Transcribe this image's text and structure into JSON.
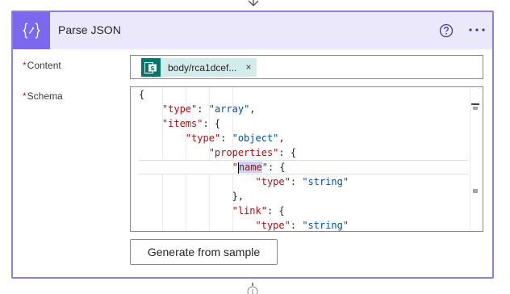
{
  "action": {
    "title": "Parse JSON",
    "icon": "curly-braces-icon",
    "accent_color": "#7b68ee",
    "header_bg": "#ece8fb",
    "border_color": "#8f7fe0"
  },
  "header_actions": {
    "help_icon": "question-circle-icon",
    "more_icon": "ellipsis-icon"
  },
  "fields": {
    "content": {
      "required_marker": "*",
      "label": "Content",
      "token": {
        "label": "body/rca1dcef...",
        "close": "×",
        "icon": "sharepoint-icon",
        "color": "#077568"
      }
    },
    "schema": {
      "required_marker": "*",
      "label": "Schema",
      "lines": [
        "{",
        "    \"type\": \"array\",",
        "    \"items\": {",
        "        \"type\": \"object\",",
        "        \"properties\": {",
        "            \"name\": {",
        "                \"type\": \"string\"",
        "            },",
        "            \"link\": {",
        "                \"type\": \"string\""
      ]
    }
  },
  "buttons": {
    "generate_label": "Generate from sample"
  }
}
